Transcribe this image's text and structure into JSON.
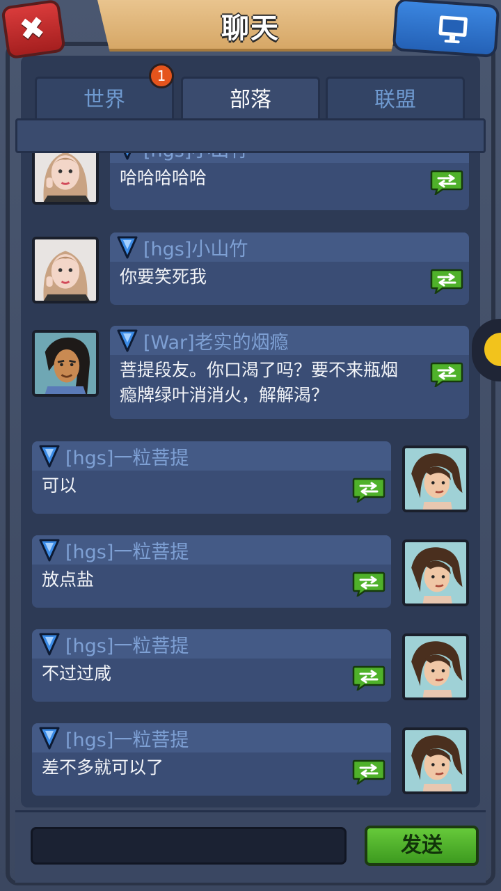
{
  "header": {
    "title": "聊天",
    "close_icon": "close-icon",
    "screen_icon": "monitor-icon"
  },
  "tabs": [
    {
      "label": "世界",
      "badge": "1",
      "active": false
    },
    {
      "label": "部落",
      "active": true
    },
    {
      "label": "联盟",
      "active": false
    }
  ],
  "messages": [
    {
      "sender": "[hgs]小山竹",
      "text": "哈哈哈哈哈",
      "side": "left",
      "avatar": "girl-photo"
    },
    {
      "sender": "[hgs]小山竹",
      "text": "你要笑死我",
      "side": "left",
      "avatar": "girl-photo"
    },
    {
      "sender": "[War]老实的烟瘾",
      "text": "菩提段友。你口渴了吗？要不来瓶烟\n瘾牌绿叶消消火，解解渴？",
      "side": "left",
      "avatar": "warrior"
    },
    {
      "sender": "[hgs]一粒菩提",
      "text": "可以",
      "side": "right",
      "avatar": "brunette"
    },
    {
      "sender": "[hgs]一粒菩提",
      "text": "放点盐",
      "side": "right",
      "avatar": "brunette"
    },
    {
      "sender": "[hgs]一粒菩提",
      "text": "不过过咸",
      "side": "right",
      "avatar": "brunette"
    },
    {
      "sender": "[hgs]一粒菩提",
      "text": "差不多就可以了",
      "side": "right",
      "avatar": "brunette"
    }
  ],
  "composer": {
    "input_value": "",
    "send_label": "发送"
  },
  "colors": {
    "accent_green": "#4fb12a",
    "tab_text_inactive": "#6f9ad0",
    "badge": "#e5541c"
  }
}
